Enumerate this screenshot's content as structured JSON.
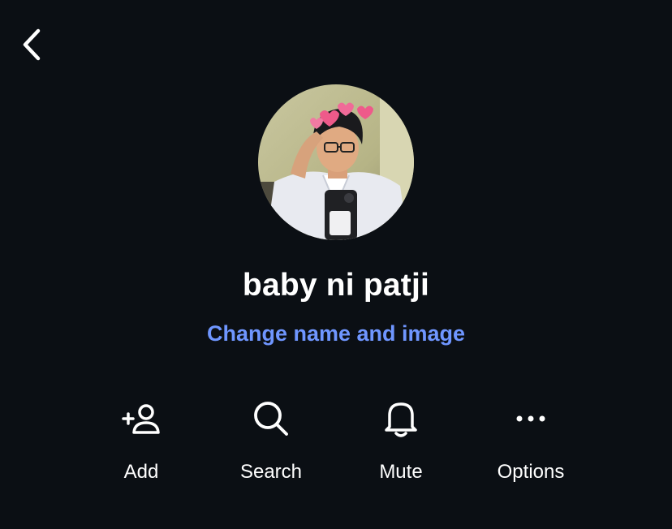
{
  "header": {
    "back_icon": "chevron-left-icon"
  },
  "profile": {
    "name": "baby ni patji",
    "change_link": "Change name and image"
  },
  "actions": [
    {
      "label": "Add",
      "icon": "add-person-icon"
    },
    {
      "label": "Search",
      "icon": "search-icon"
    },
    {
      "label": "Mute",
      "icon": "bell-icon"
    },
    {
      "label": "Options",
      "icon": "more-horizontal-icon"
    }
  ],
  "colors": {
    "background": "#0b0f14",
    "link": "#6f96ff",
    "text": "#ffffff"
  }
}
